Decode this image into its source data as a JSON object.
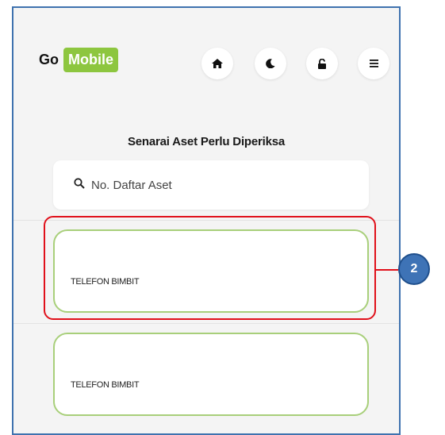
{
  "header": {
    "logo_go": "Go",
    "logo_mobile": "Mobile",
    "nav": [
      {
        "icon": "home-icon"
      },
      {
        "icon": "moon-icon"
      },
      {
        "icon": "lock-icon"
      },
      {
        "icon": "menu-icon"
      }
    ]
  },
  "page": {
    "title": "Senarai Aset Perlu Diperiksa"
  },
  "search": {
    "placeholder": "No. Daftar Aset",
    "value": ""
  },
  "assets": [
    {
      "name": "TELEFON BIMBIT"
    },
    {
      "name": "TELEFON BIMBIT"
    }
  ],
  "annotation": {
    "number": "2",
    "color": "#e0101a"
  },
  "colors": {
    "brand": "#8dc63f",
    "frame": "#3f72af",
    "card_border": "#a8cf7a",
    "callout": "#3e73b6"
  }
}
